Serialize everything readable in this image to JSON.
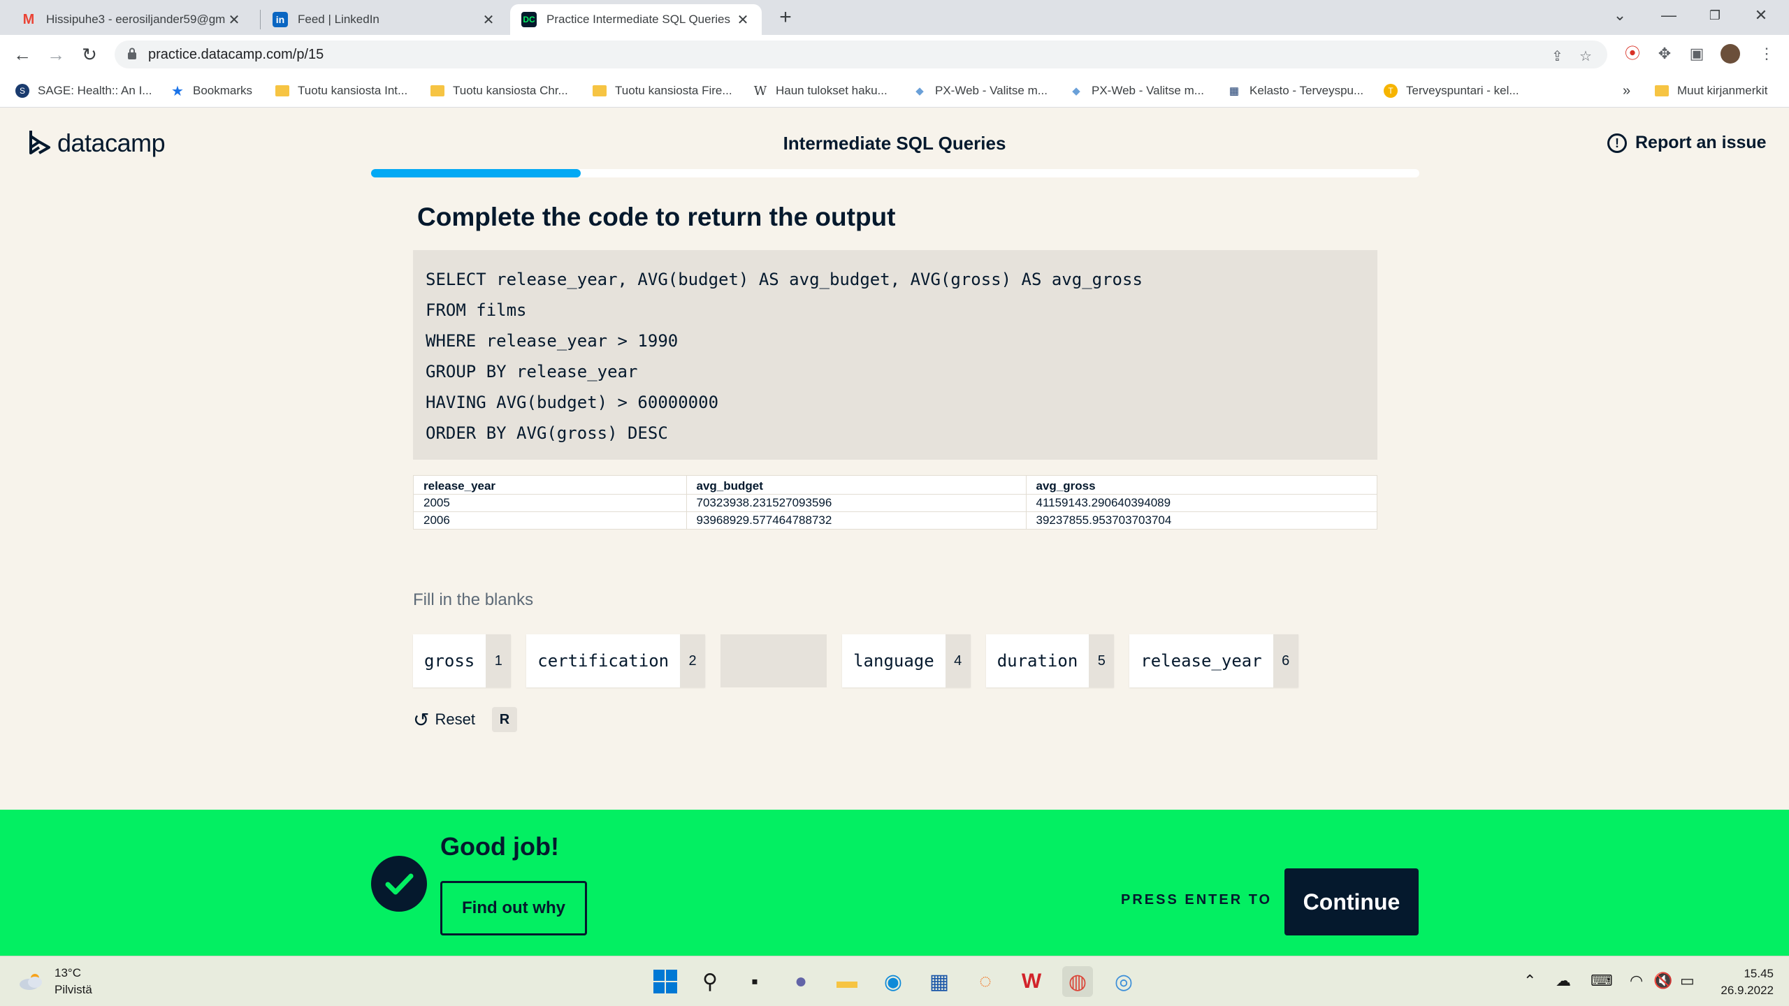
{
  "browser": {
    "tabs": [
      {
        "title": "Hissipuhe3 - eerosiljander59@gm",
        "icon": "gmail-icon"
      },
      {
        "title": "Feed | LinkedIn",
        "icon": "linkedin-icon"
      },
      {
        "title": "Practice Intermediate SQL Queries",
        "icon": "datacamp-icon",
        "active": true
      }
    ],
    "url": "practice.datacamp.com/p/15",
    "bookmarks": [
      "SAGE: Health:: An I...",
      "Bookmarks",
      "Tuotu kansiosta Int...",
      "Tuotu kansiosta Chr...",
      "Tuotu kansiosta Fire...",
      "Haun tulokset haku...",
      "PX-Web - Valitse m...",
      "PX-Web - Valitse m...",
      "Kelasto - Terveyspu...",
      "Terveyspuntari - kel..."
    ],
    "more_bookmarks": "»",
    "other_bookmarks": "Muut kirjanmerkit"
  },
  "page": {
    "logo": "datacamp",
    "course_title": "Intermediate SQL Queries",
    "report": "Report an issue",
    "progress": 0.2,
    "question": "Complete the code to return the output",
    "code": [
      "SELECT release_year, AVG(budget) AS avg_budget, AVG(gross) AS avg_gross",
      "FROM films",
      "WHERE release_year > 1990",
      "GROUP BY release_year",
      "HAVING AVG(budget) > 60000000",
      "ORDER BY AVG(gross) DESC"
    ],
    "result": {
      "columns": [
        "release_year",
        "avg_budget",
        "avg_gross"
      ],
      "rows": [
        [
          "2005",
          "70323938.231527093596",
          "41159143.290640394089"
        ],
        [
          "2006",
          "93968929.577464788732",
          "39237855.953703703704"
        ]
      ]
    },
    "fill_label": "Fill in the blanks",
    "blanks": [
      {
        "text": "gross",
        "key": "1"
      },
      {
        "text": "certification",
        "key": "2"
      },
      {
        "text": "",
        "key": ""
      },
      {
        "text": "language",
        "key": "4"
      },
      {
        "text": "duration",
        "key": "5"
      },
      {
        "text": "release_year",
        "key": "6"
      }
    ],
    "reset": "Reset",
    "reset_key": "R"
  },
  "feedback": {
    "title": "Good job!",
    "find_out": "Find out why",
    "press": "PRESS ENTER TO",
    "continue": "Continue"
  },
  "taskbar": {
    "temp": "13°C",
    "weather": "Pilvistä",
    "time": "15.45",
    "date": "26.9.2022"
  },
  "colors": {
    "brand_dark": "#05192d",
    "success_green": "#03ef62",
    "progress_blue": "#03a9f4",
    "page_bg": "#f7f3eb"
  }
}
